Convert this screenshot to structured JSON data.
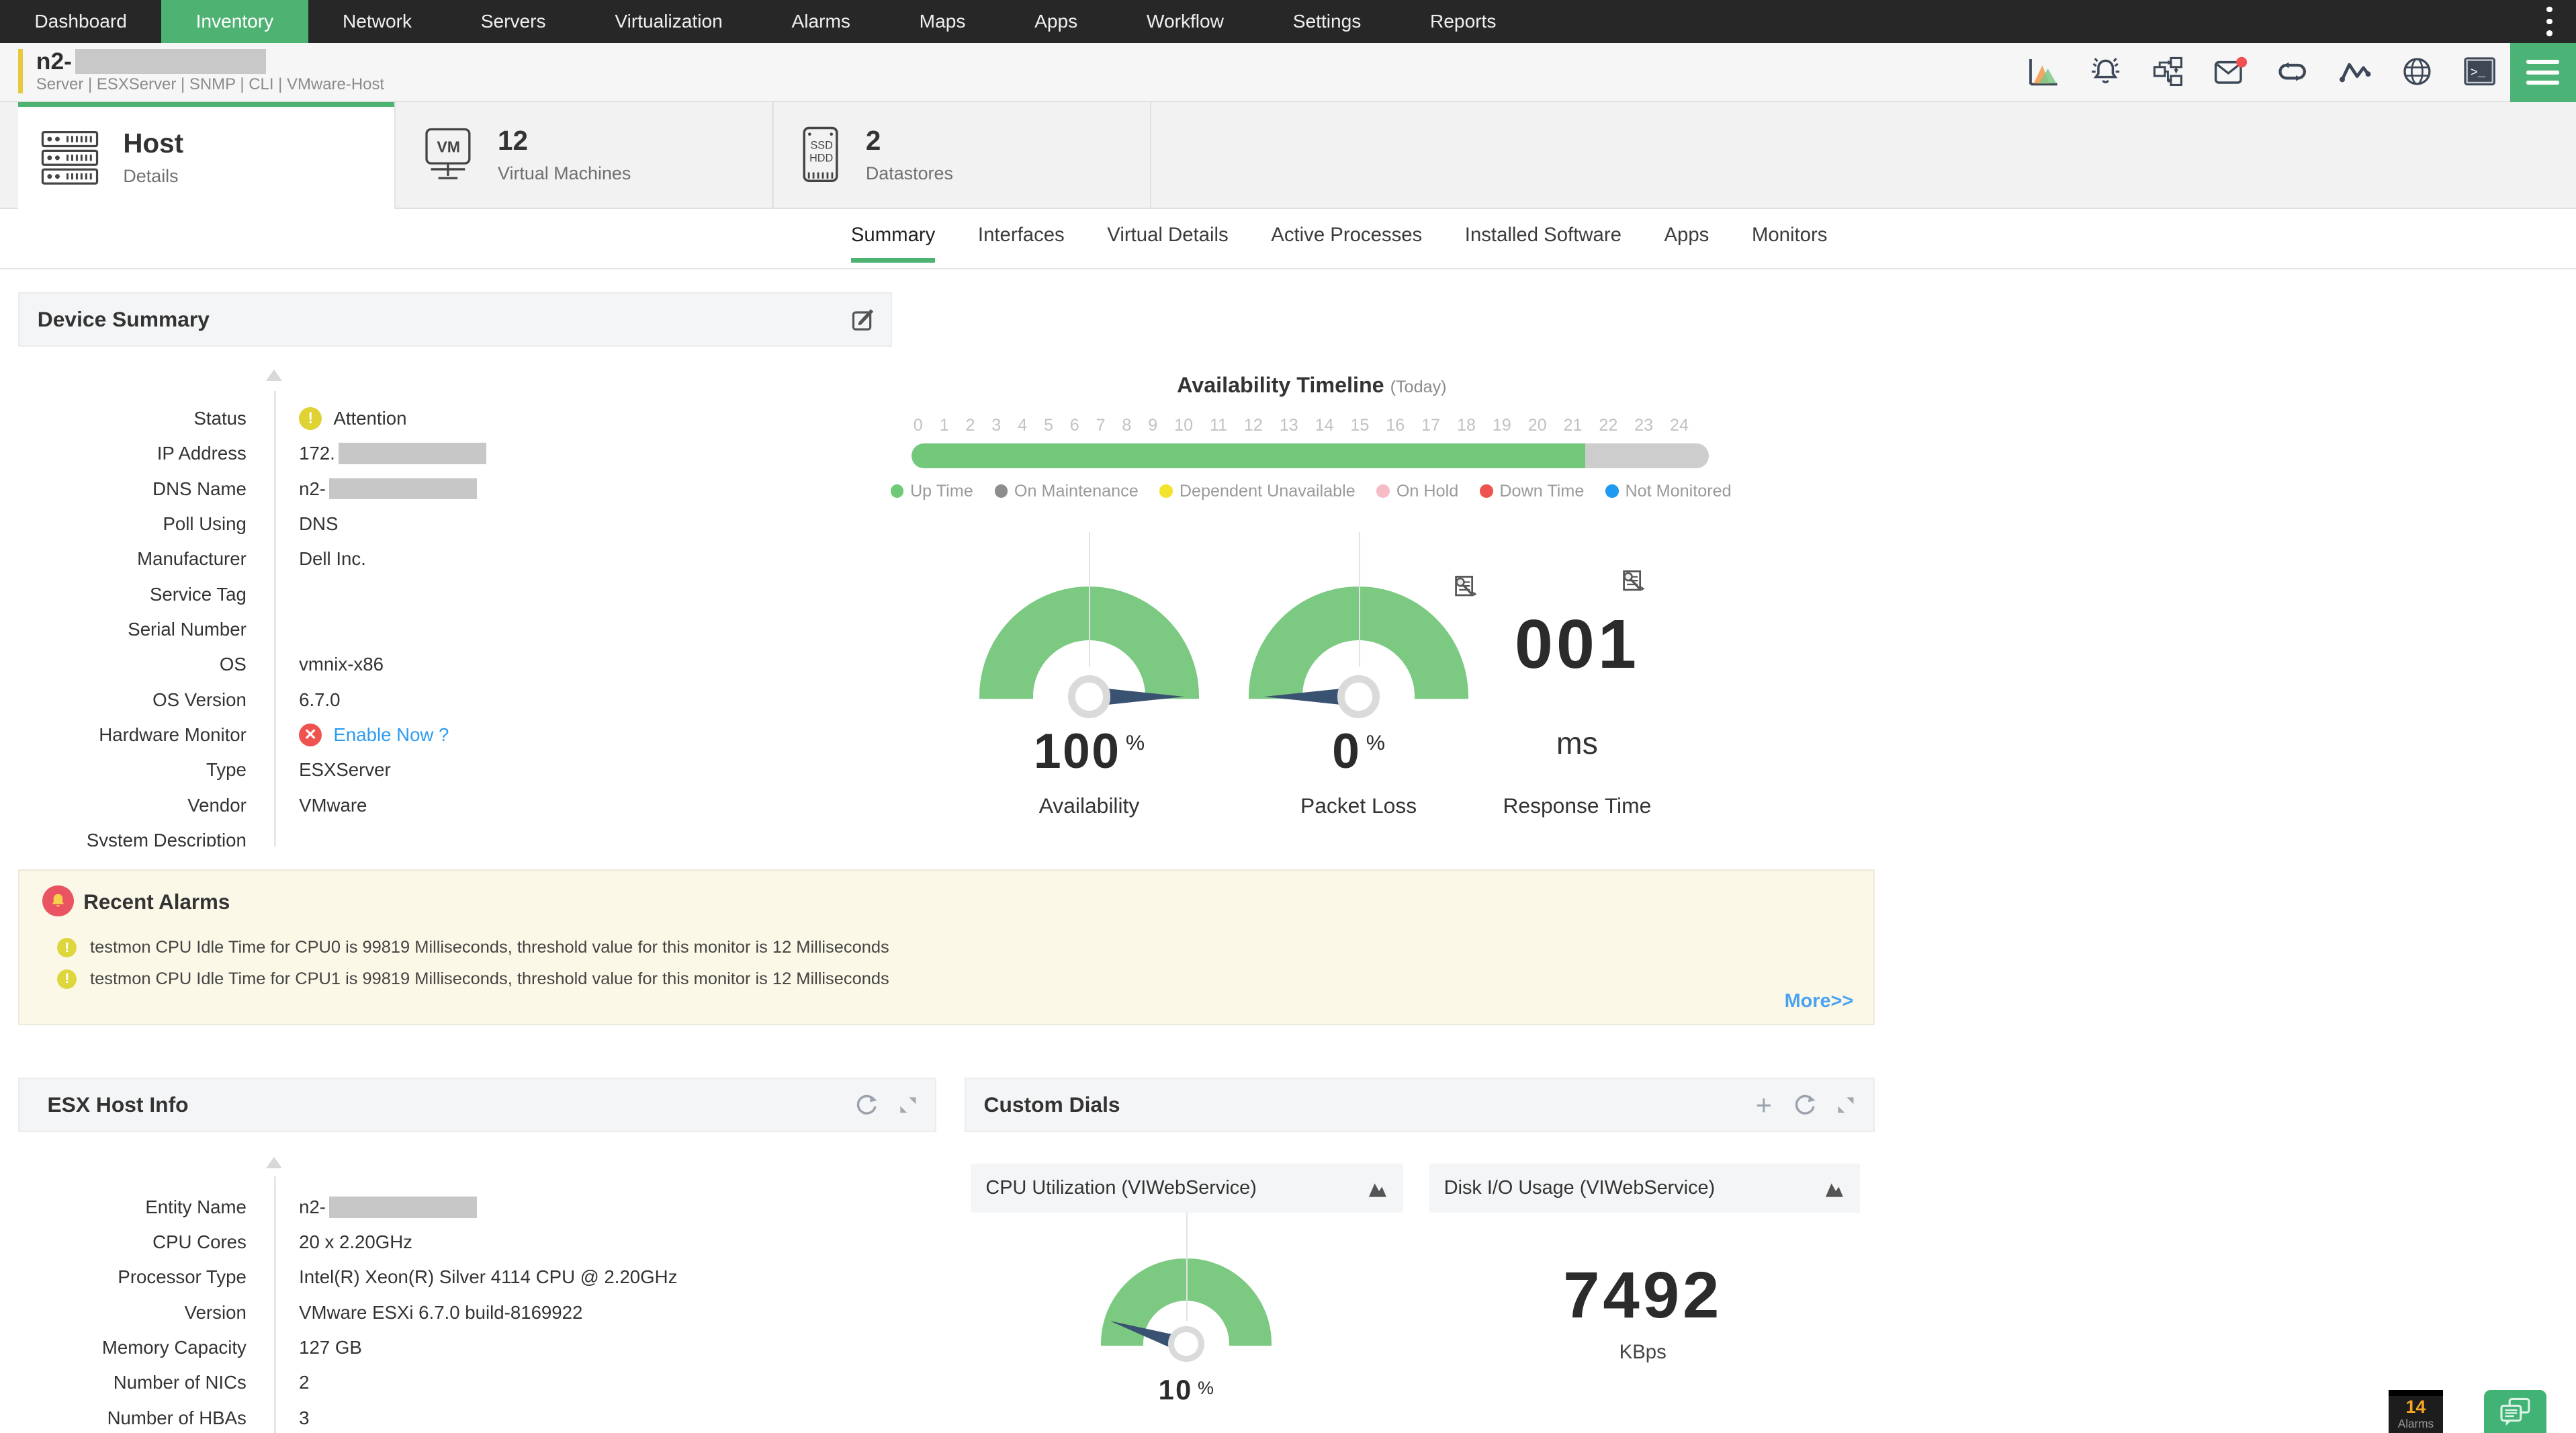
{
  "nav": {
    "items": [
      {
        "label": "Dashboard"
      },
      {
        "label": "Inventory"
      },
      {
        "label": "Network"
      },
      {
        "label": "Servers"
      },
      {
        "label": "Virtualization"
      },
      {
        "label": "Alarms"
      },
      {
        "label": "Maps"
      },
      {
        "label": "Apps"
      },
      {
        "label": "Workflow"
      },
      {
        "label": "Settings"
      },
      {
        "label": "Reports"
      }
    ],
    "active": "Inventory"
  },
  "device_header": {
    "name": "n2-",
    "meta": "Server | ESXServer | SNMP | CLI | VMware-Host",
    "icons": [
      "area-chart",
      "alarm-bell",
      "workflow",
      "mail-notification",
      "loop-link",
      "pulse",
      "globe",
      "terminal",
      "menu"
    ]
  },
  "tabs": {
    "host": {
      "title": "Host",
      "subtitle": "Details"
    },
    "vms": {
      "count": "12",
      "label": "Virtual Machines"
    },
    "datastores": {
      "count": "2",
      "label": "Datastores"
    }
  },
  "subtabs": {
    "items": [
      "Summary",
      "Interfaces",
      "Virtual Details",
      "Active Processes",
      "Installed Software",
      "Apps",
      "Monitors"
    ],
    "active": "Summary"
  },
  "device_summary": {
    "title": "Device Summary",
    "rows": [
      {
        "label": "Status",
        "value": "Attention",
        "icon": "attention-yellow"
      },
      {
        "label": "IP Address",
        "value": "172.",
        "redacted": true
      },
      {
        "label": "DNS Name",
        "value": "n2-",
        "redacted": true
      },
      {
        "label": "Poll Using",
        "value": "DNS"
      },
      {
        "label": "Manufacturer",
        "value": "Dell Inc."
      },
      {
        "label": "Service Tag",
        "value": ""
      },
      {
        "label": "Serial Number",
        "value": ""
      },
      {
        "label": "OS",
        "value": "vmnix-x86"
      },
      {
        "label": "OS Version",
        "value": "6.7.0"
      },
      {
        "label": "Hardware Monitor",
        "value": "Enable Now ?",
        "icon": "error-red",
        "link": true
      },
      {
        "label": "Type",
        "value": "ESXServer"
      },
      {
        "label": "Vendor",
        "value": "VMware"
      },
      {
        "label": "System Description",
        "value": ""
      }
    ]
  },
  "availability_timeline": {
    "title": "Availability Timeline",
    "subtitle": "(Today)",
    "hours": [
      "0",
      "1",
      "2",
      "3",
      "4",
      "5",
      "6",
      "7",
      "8",
      "9",
      "10",
      "11",
      "12",
      "13",
      "14",
      "15",
      "16",
      "17",
      "18",
      "19",
      "20",
      "21",
      "22",
      "23",
      "24"
    ],
    "up_hours": 20.3,
    "total_hours": 24,
    "up_percent": 84.5,
    "legend": [
      {
        "label": "Up Time",
        "color": "#6fca77"
      },
      {
        "label": "On Maintenance",
        "color": "#8d8d8d"
      },
      {
        "label": "Dependent Unavailable",
        "color": "#f3e32c"
      },
      {
        "label": "On Hold",
        "color": "#f6bcc6"
      },
      {
        "label": "Down Time",
        "color": "#ef5350"
      },
      {
        "label": "Not Monitored",
        "color": "#1e9bf0"
      }
    ]
  },
  "gauges": {
    "availability": {
      "value": "100",
      "unit": "%",
      "label": "Availability",
      "needle_percent": 100
    },
    "packet_loss": {
      "value": "0",
      "unit": "%",
      "label": "Packet Loss",
      "needle_percent": 0
    },
    "response_time": {
      "value": "001",
      "unit": "ms",
      "label": "Response Time"
    }
  },
  "recent_alarms": {
    "title": "Recent Alarms",
    "items": [
      "testmon CPU Idle Time for CPU0 is 99819 Milliseconds, threshold value for this monitor is 12 Milliseconds",
      "testmon CPU Idle Time for CPU1 is 99819 Milliseconds, threshold value for this monitor is 12 Milliseconds"
    ],
    "more_label": "More>>"
  },
  "esx_host_info": {
    "title": "ESX Host Info",
    "rows": [
      {
        "label": "Entity Name",
        "value": "n2-",
        "redacted": true
      },
      {
        "label": "CPU Cores",
        "value": "20 x 2.20GHz"
      },
      {
        "label": "Processor Type",
        "value": "Intel(R) Xeon(R) Silver 4114 CPU @ 2.20GHz"
      },
      {
        "label": "Version",
        "value": "VMware ESXi 6.7.0 build-8169922"
      },
      {
        "label": "Memory Capacity",
        "value": "127 GB"
      },
      {
        "label": "Number of NICs",
        "value": "2"
      },
      {
        "label": "Number of HBAs",
        "value": "3"
      }
    ]
  },
  "custom_dials": {
    "title": "Custom Dials",
    "dials": [
      {
        "name": "CPU Utilization (VIWebService)",
        "value": "10",
        "unit": "%",
        "needle_percent": 10
      },
      {
        "name": "Disk I/O Usage (VIWebService)",
        "value": "7492",
        "unit": "KBps"
      }
    ]
  },
  "footer": {
    "alarm_count": "14",
    "alarm_label": "Alarms",
    "icons": [
      "chat"
    ]
  },
  "colors": {
    "brand_green": "#4eb273",
    "gauge_green": "#7cc981",
    "needle_navy": "#3a5271",
    "attention_yellow": "#e0d232",
    "error_red": "#ef5350",
    "link_blue": "#2e9bf0",
    "alarm_panel_bg": "#fcf8e7",
    "accent_yellow": "#e6c93c"
  }
}
